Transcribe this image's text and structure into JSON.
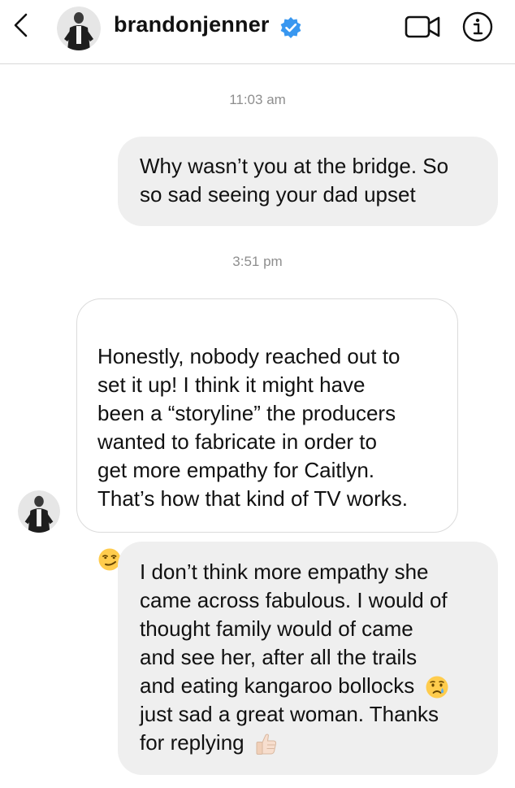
{
  "header": {
    "username": "brandonjenner",
    "verified": true,
    "icons": {
      "back": "chevron-left-icon",
      "verified": "verified-badge-icon",
      "video": "video-call-icon",
      "info": "info-icon"
    },
    "colors": {
      "verified": "#3897f0",
      "divider": "#d8d8d8"
    }
  },
  "thread": {
    "timestamps": [
      "11:03 am",
      "3:51 pm"
    ],
    "messages": [
      {
        "direction": "sent",
        "text": "Why wasn’t you at the bridge. So\nso sad seeing your dad upset"
      },
      {
        "direction": "received",
        "text": "Honestly, nobody reached out to\nset it up! I think it might have\nbeen a “storyline” the producers\nwanted to fabricate in order to\nget more empathy for Caitlyn.\nThat’s how that kind of TV works.",
        "emoji": "smirk-emoji"
      },
      {
        "direction": "sent",
        "text_lines": [
          "I don’t think more empathy she",
          "came across fabulous. I would of",
          "thought family would of came",
          "and see her, after all the trails",
          "and eating kangaroo bollocks",
          "just sad a great woman. Thanks",
          "for replying"
        ],
        "emojis": [
          "crying-face-emoji",
          "thumbs-up-emoji"
        ]
      }
    ],
    "colors": {
      "sent_bubble": "#efefef",
      "received_border": "#dbdbdb",
      "timestamp": "#8e8e8e"
    }
  }
}
